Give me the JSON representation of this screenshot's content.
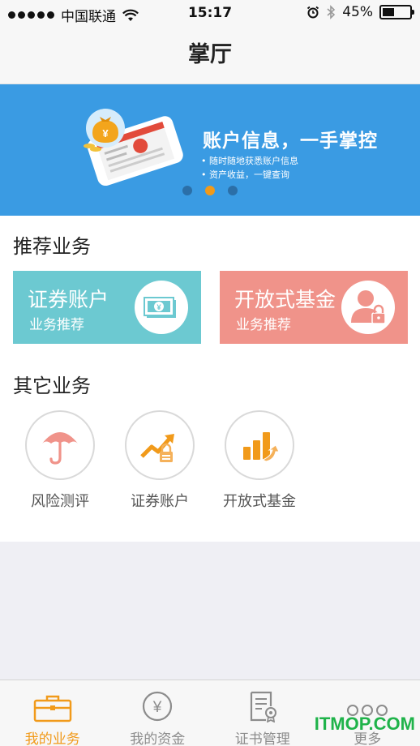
{
  "status_bar": {
    "carrier": "中国联通",
    "time": "15:17",
    "battery": "45%",
    "battery_level": 0.45
  },
  "nav": {
    "title": "掌厅"
  },
  "banner": {
    "title": "账户信息，一手掌控",
    "bullets": [
      "随时随地获悉账户信息",
      "资产收益，一键查询"
    ],
    "page_count": 3,
    "active_page": 2
  },
  "recommended": {
    "title": "推荐业务",
    "cards": [
      {
        "title": "证券账户",
        "subtitle": "业务推荐",
        "color": "#6cc9d1",
        "icon": "money-stack-icon"
      },
      {
        "title": "开放式基金",
        "subtitle": "业务推荐",
        "color": "#f0938a",
        "icon": "user-lock-icon"
      }
    ]
  },
  "other": {
    "title": "其它业务",
    "items": [
      {
        "label": "风险测评",
        "icon": "umbrella-icon"
      },
      {
        "label": "证券账户",
        "icon": "trend-lock-icon"
      },
      {
        "label": "开放式基金",
        "icon": "bar-chart-arrow-icon"
      }
    ]
  },
  "tabbar": {
    "tabs": [
      {
        "label": "我的业务",
        "icon": "briefcase-icon",
        "active": true
      },
      {
        "label": "我的资金",
        "icon": "yuan-icon",
        "active": false
      },
      {
        "label": "证书管理",
        "icon": "certificate-icon",
        "active": false
      },
      {
        "label": "更多",
        "icon": "more-icon",
        "active": false
      }
    ]
  },
  "watermark": "ITMOP.COM",
  "colors": {
    "accent": "#f19a1a",
    "banner": "#3a9be3",
    "teal": "#6cc9d1",
    "pink": "#f0938a"
  }
}
